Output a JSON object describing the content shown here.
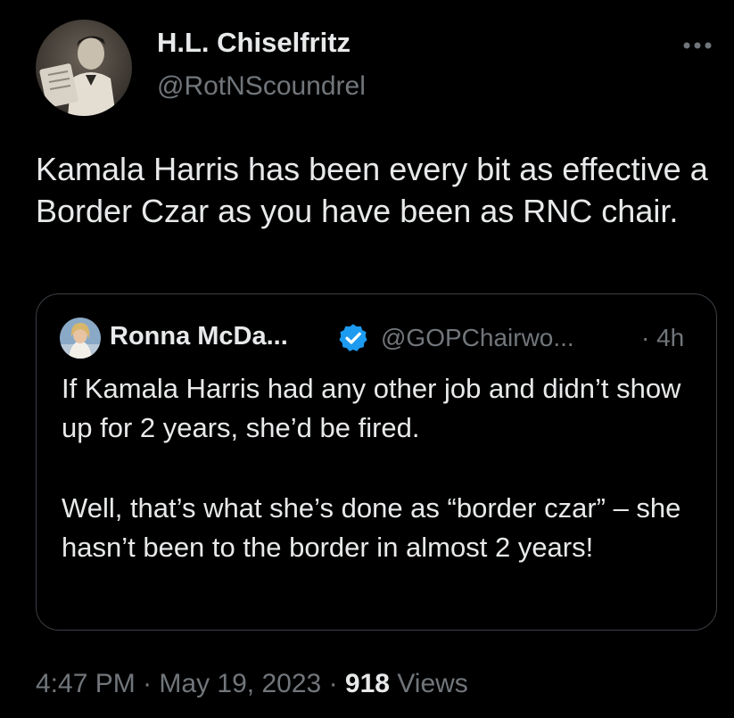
{
  "tweet": {
    "author": {
      "name": "H.L. Chiselfritz",
      "handle": "@RotNScoundrel"
    },
    "more_icon": "more-horizontal-icon",
    "text": "Kamala Harris has been every bit as effective a Border Czar as you have been as RNC chair.",
    "quoted_tweet": {
      "name": "Ronna McDa...",
      "verified_icon": "verified-badge-icon",
      "handle": "@GOPChairwo...",
      "separator": "·",
      "time": "4h",
      "paragraphs": [
        "If Kamala Harris had any other job and didn’t show up for 2 years, she’d be fired.",
        "Well, that’s what she’s done as “border czar” – she hasn’t been to the border in almost 2 years!"
      ]
    },
    "meta": {
      "time": "4:47 PM",
      "separator": "·",
      "date": "May 19, 2023",
      "separator2": "·",
      "views_count": "918",
      "views_label": "Views"
    }
  },
  "colors": {
    "background": "#000000",
    "primary_text": "#e7e9ea",
    "secondary_text": "#71767b",
    "verified_blue": "#1d9bf0",
    "card_border": "#3a3f44"
  }
}
